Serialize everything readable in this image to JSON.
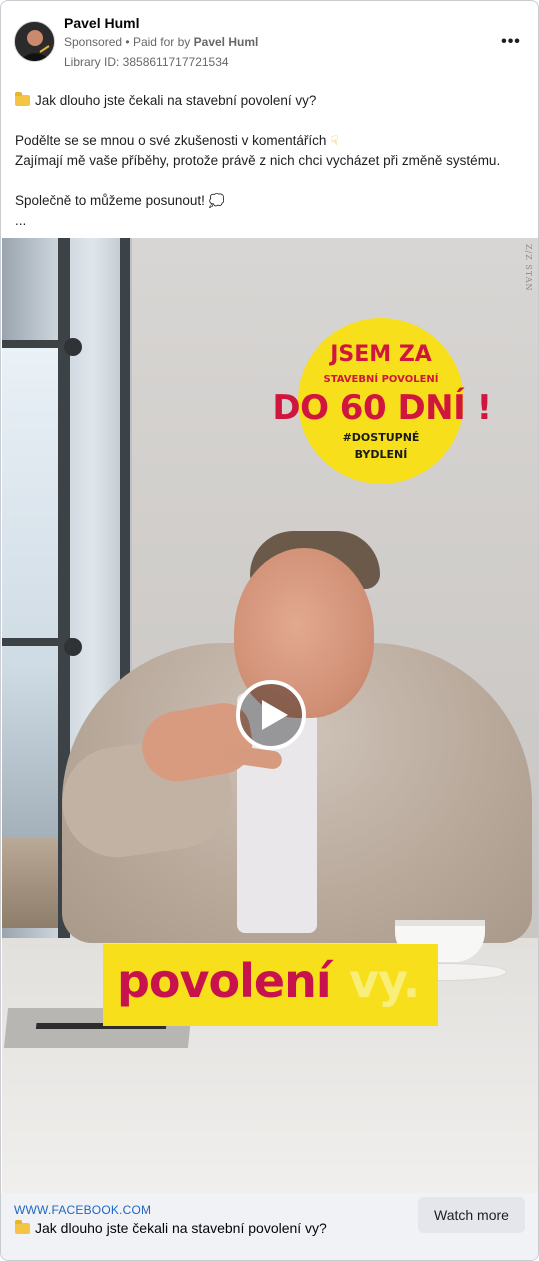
{
  "ad": {
    "author": "Pavel Huml",
    "sponsored_label": "Sponsored",
    "separator": "•",
    "paid_for_prefix": "Paid for by",
    "paid_for_name": "Pavel Huml",
    "library_id": "Library ID: 3858611717721534",
    "more_icon": "more-horizontal-icon"
  },
  "post": {
    "line1": "Jak dlouho jste čekali na stavební povolení vy?",
    "line2": "Podělte se se mnou o své zkušenosti v komentářích",
    "line3": "Zajímají mě vaše příběhy, protože právě z nich chci vycházet při změně systému.",
    "line4": "Společně to můžeme posunout!",
    "truncation": "..."
  },
  "video": {
    "watermark": "Z/Z STAN",
    "badge_line1": "JSEM ZA",
    "badge_line2": "STAVEBNÍ POVOLENÍ",
    "badge_line3": "DO 60 DNÍ !",
    "badge_line4": "#DOSTUPNÉ",
    "badge_line5": "BYDLENÍ",
    "caption_word1": "povolení",
    "caption_word2": "vy.",
    "play_icon": "play-icon",
    "colors": {
      "badge": "#f7e01b",
      "accent_red": "#d0163f",
      "caption_magenta": "#c8124d"
    }
  },
  "footer": {
    "domain": "WWW.FACEBOOK.COM",
    "title": "Jak dlouho jste čekali na stavební povolení vy?",
    "cta": "Watch more"
  }
}
